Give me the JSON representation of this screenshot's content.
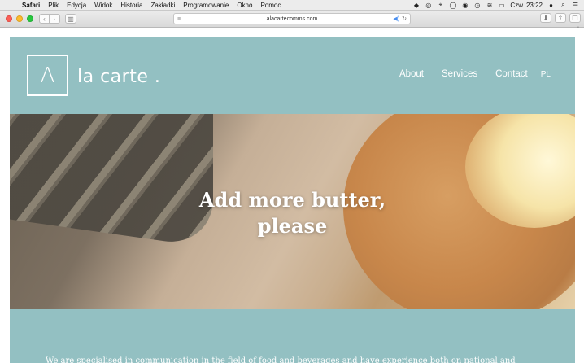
{
  "menubar": {
    "apple": "",
    "items": [
      "Safari",
      "Plik",
      "Edycja",
      "Widok",
      "Historia",
      "Zakładki",
      "Programowanie",
      "Okno",
      "Pomoc"
    ],
    "clock": "Czw. 23:22"
  },
  "toolbar": {
    "url": "alacartecomms.com",
    "back_glyph": "‹",
    "forward_glyph": "›",
    "new_tab_glyph": "+"
  },
  "site": {
    "logo_letter": "A",
    "logo_text": "la carte .",
    "nav": [
      "About",
      "Services",
      "Contact",
      "PL"
    ],
    "hero_title_line1": "Add more butter,",
    "hero_title_line2": "please",
    "intro_text": "We are specialised in communication in the field of food and beverages and have experience both on national and"
  },
  "colors": {
    "brand_teal": "#93c0c2"
  }
}
